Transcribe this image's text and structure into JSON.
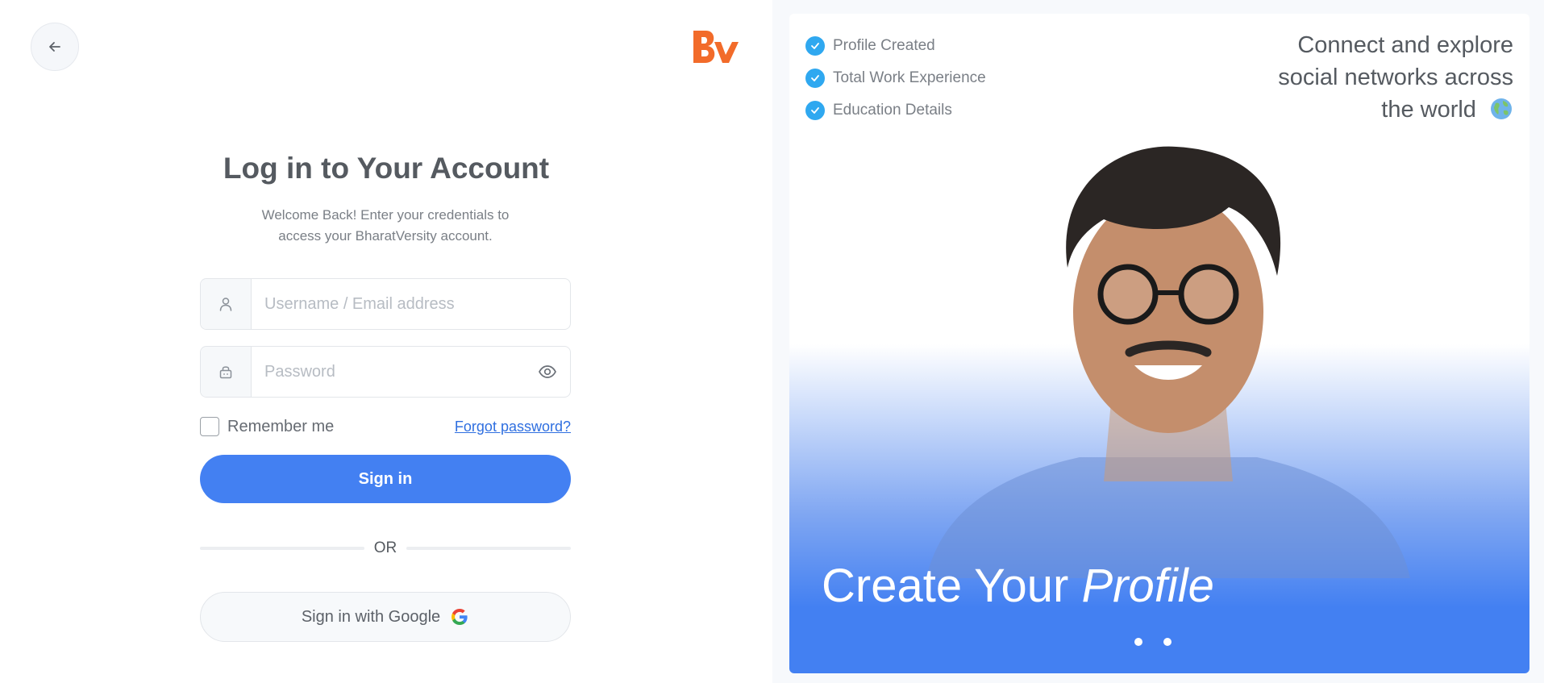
{
  "login": {
    "title": "Log in to Your Account",
    "subtitle": "Welcome Back! Enter your credentials to access your BharatVersity account.",
    "username_placeholder": "Username / Email address",
    "username_value": "",
    "password_placeholder": "Password",
    "password_value": "",
    "remember_label": "Remember me",
    "forgot_label": "Forgot password?",
    "signin_label": "Sign in",
    "or_label": "OR",
    "google_label": "Sign in with Google"
  },
  "promo": {
    "checklist": [
      "Profile Created",
      "Total Work Experience",
      "Education Details"
    ],
    "tagline": "Connect and explore social networks across the world",
    "headline_prefix": "Create Your",
    "headline_emphasis": "Profile",
    "slide_count": 2
  },
  "icons": {
    "back": "arrow-left-icon",
    "logo": "bharatversity-logo",
    "user": "user-icon",
    "lock": "lock-icon",
    "eye": "eye-icon",
    "check": "check-circle-icon",
    "globe": "globe-icon",
    "google": "google-g-icon"
  },
  "colors": {
    "primary": "#4380f2",
    "logo": "#f26b2a",
    "check": "#2fa8f0",
    "link": "#2f6fe0"
  }
}
